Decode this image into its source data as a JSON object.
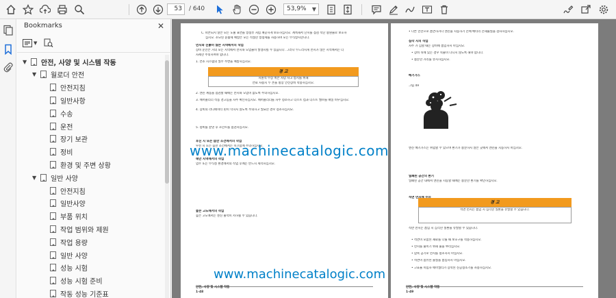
{
  "toolbar": {
    "page_current": "53",
    "page_total": "/ 640",
    "zoom": "53,9%"
  },
  "panel": {
    "title": "Bookmarks",
    "tree": [
      {
        "label": "안전, 사양 및 시스템 작동",
        "level": 0,
        "arrow": "▼"
      },
      {
        "label": "월로더 안전",
        "level": 1,
        "arrow": "▼"
      },
      {
        "label": "안전지침",
        "level": 2,
        "arrow": ""
      },
      {
        "label": "일반사항",
        "level": 2,
        "arrow": ""
      },
      {
        "label": "수송",
        "level": 2,
        "arrow": ""
      },
      {
        "label": "운전",
        "level": 2,
        "arrow": ""
      },
      {
        "label": "장기 보관",
        "level": 2,
        "arrow": ""
      },
      {
        "label": "정비",
        "level": 2,
        "arrow": ""
      },
      {
        "label": "환경 및 주변 상황",
        "level": 2,
        "arrow": ""
      },
      {
        "label": "일반 사양",
        "level": 1,
        "arrow": "▼"
      },
      {
        "label": "안전지침",
        "level": 2,
        "arrow": ""
      },
      {
        "label": "일반사양",
        "level": 2,
        "arrow": ""
      },
      {
        "label": "부품 위치",
        "level": 2,
        "arrow": ""
      },
      {
        "label": "작업 범위와 제원",
        "level": 2,
        "arrow": ""
      },
      {
        "label": "작업 용량",
        "level": 2,
        "arrow": ""
      },
      {
        "label": "일반 사양",
        "level": 2,
        "arrow": ""
      },
      {
        "label": "성능 시험",
        "level": 2,
        "arrow": ""
      },
      {
        "label": "성능 시험 준비",
        "level": 2,
        "arrow": ""
      },
      {
        "label": "작동 성능 기준표",
        "level": 2,
        "arrow": ""
      }
    ]
  },
  "left_page": {
    "lines": [
      "C. 파손되지 않은 모든 노출 표면을 방청유 처럼 깨끗하게 보호하십시오. 계속해서 단지를 점검 작단 왕원물로 보호하",
      "십시오. 소모된 윤활제 예방은 모든 적절한 방청제를 사용하여 모든 부식방지한니다.",
      "먼지와 진흙이 많은 지역에서의 작업",
      "장비 운전은 거의 모든 지역에서 먼지와 오염물이 발생시킬 수 있습니다. 그러나 두드러지게 먼지가 많은 지역에서는 더",
      "자세한 주의하여야 합니다.",
      "1. 연소 시스템의 필수 주변을 예방하십시오.",
      "지원적 부상 혹은 사망 사고 방지를 위해",
      "연료 사용시 두 손을 항상 안전장비 착용하십시오.",
      "2. 엔진 계통을 점검할 때에는 먼지와 오염이 없도록 주의하십시오.",
      "3. 에어클리너 작동 경고등을 자주 확인하십시오. 에어클리너를 자주 청소하고 더스트 컵과 더스트 밸브를 매일 비우십시오.",
      "4. 장비의 라디에이터 핀이 막히지 않도록 주의하고 필요한 경우 청소하십시오.",
      "5. 정비를 끝낸 후 조인트를 점검하십시오.",
      "후진 시 또는 습한 조건에서의 작업",
      "우천 시 또는 습한 조건에서는 미끄럼에 주의하십시오.",
      "해안 지역에서의 작업",
      "염수 또는 부식성 환경에서의 작업 후에는 반드시 세척하십시오.",
      "높은 고도에서의 작업",
      "높은 고도에서는 엔진 출력이 저하될 수 있습니다."
    ],
    "warn_title": "경 고",
    "footer_title": "안전, 사양 및 시스템 작동",
    "footer_page": "1-48"
  },
  "right_page": {
    "lines": [
      "• 다른 안전으로 흡연하거나 엔진을 시동하기 전에 배터리 전해물질을 검사하십시오.",
      "심각 시의 작업",
      "자주 가 심할 때는 장비에 흡입하지 마십시오.",
      "• 장비 뒤에 있는 경우 목줄이 다니지 않도록 해야 합니다.",
      "• 충분한 거리를 유지하십시오.",
      "배기가스",
      "그림 49",
      "엔진 배기가스는 위험할 수 있으며 환기가 충분하지 않은 곳에서 엔진을 시동하지 마십시오.",
      "밀폐된 공간의 환기",
      "밀폐된 공간 내에서 엔진을 시동할 때에는 충분한 환기를 확인하십시오.",
      "석면 먼지에 주의",
      "석면 먼지는 흡입 시 심각한 질환을 유발할 수 있습니다.",
      "• 석면이 포함된 재료를 다룰 때 보호구를 착용하십시오.",
      "• 먼지를 줄이기 위해 물을 뿌리십시오.",
      "• 압축 공기로 먼지를 청소하지 마십시오.",
      "• 석면이 함유된 물질을 흡입하지 마십시오.",
      "• 고효율 미립자 에어필터가 장착된 진공청소기를 사용하십시오."
    ],
    "warn_title": "경 고",
    "footer_title": "안전, 사양 및 시스템 작동",
    "footer_page": "1-49"
  },
  "watermark": "www.machinecatalogic.com",
  "watermark2": "www.machinecatalogic.com",
  "colors": {
    "warning": "#f29a1e",
    "watermark": "#0080c8",
    "accent": "#1e6fd9"
  }
}
